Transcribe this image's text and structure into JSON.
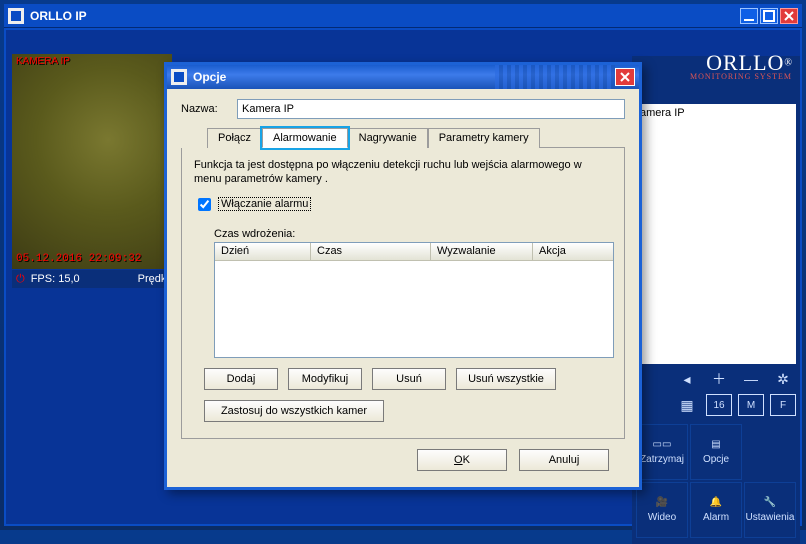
{
  "main_window": {
    "title": "ORLLO IP",
    "brand": {
      "name": "ORLLO",
      "tag": "MONITORING SYSTEM"
    },
    "video": {
      "label": "KAMERA IP",
      "timestamp": "05.12.2016 22:09:32"
    },
    "status": {
      "fps_label": "FPS: 15,0",
      "speed_label": "Prędkoś"
    },
    "right_panel": {
      "camera_card_title": "amera IP",
      "buttons": {
        "stop": "Zatrzymaj",
        "options": "Opcje",
        "video": "Wideo",
        "alarm": "Alarm",
        "settings": "Ustawienia"
      }
    }
  },
  "dialog": {
    "title": "Opcje",
    "name_label": "Nazwa:",
    "name_value": "Kamera IP",
    "tabs": {
      "connect": "Połącz",
      "alarm": "Alarmowanie",
      "record": "Nagrywanie",
      "params": "Parametry kamery"
    },
    "alarm_tab": {
      "description": "Funkcja ta jest dostępna po włączeniu detekcji ruchu lub wejścia alarmowego w menu parametrów kamery .",
      "enable_label": "Włączanie alarmu",
      "schedule_title": "Czas wdrożenia:",
      "columns": {
        "day": "Dzień",
        "time": "Czas",
        "trigger": "Wyzwalanie",
        "action": "Akcja"
      },
      "buttons": {
        "add": "Dodaj",
        "modify": "Modyfikuj",
        "delete": "Usuń",
        "delete_all": "Usuń wszystkie",
        "apply_all": "Zastosuj do wszystkich kamer"
      }
    },
    "footer": {
      "ok": "OK",
      "cancel": "Anuluj"
    }
  }
}
